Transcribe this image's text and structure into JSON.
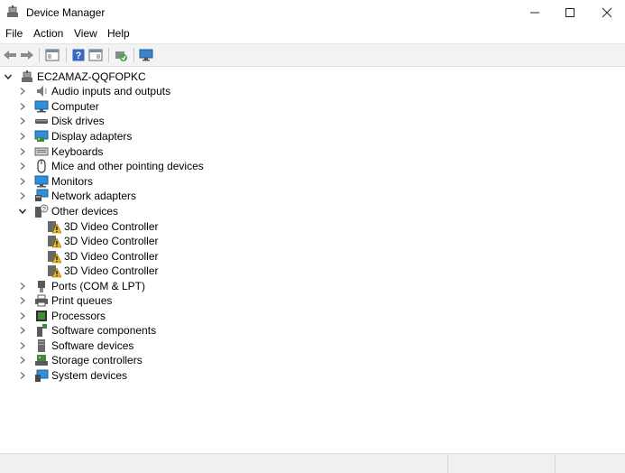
{
  "window": {
    "title": "Device Manager"
  },
  "menu": [
    "File",
    "Action",
    "View",
    "Help"
  ],
  "tree": {
    "root": "EC2AMAZ-QQFOPKC",
    "categories": [
      {
        "label": "Audio inputs and outputs",
        "icon": "speaker-icon"
      },
      {
        "label": "Computer",
        "icon": "computer-icon"
      },
      {
        "label": "Disk drives",
        "icon": "disk-drive-icon"
      },
      {
        "label": "Display adapters",
        "icon": "display-adapter-icon"
      },
      {
        "label": "Keyboards",
        "icon": "keyboard-icon"
      },
      {
        "label": "Mice and other pointing devices",
        "icon": "mouse-icon"
      },
      {
        "label": "Monitors",
        "icon": "monitor-icon"
      },
      {
        "label": "Network adapters",
        "icon": "network-adapter-icon"
      },
      {
        "label": "Other devices",
        "icon": "unknown-device-icon",
        "expanded": true,
        "children": [
          "3D Video Controller",
          "3D Video Controller",
          "3D Video Controller",
          "3D Video Controller"
        ]
      },
      {
        "label": "Ports (COM & LPT)",
        "icon": "port-icon"
      },
      {
        "label": "Print queues",
        "icon": "printer-icon"
      },
      {
        "label": "Processors",
        "icon": "processor-icon"
      },
      {
        "label": "Software components",
        "icon": "software-component-icon"
      },
      {
        "label": "Software devices",
        "icon": "software-device-icon"
      },
      {
        "label": "Storage controllers",
        "icon": "storage-controller-icon"
      },
      {
        "label": "System devices",
        "icon": "system-device-icon"
      }
    ]
  }
}
